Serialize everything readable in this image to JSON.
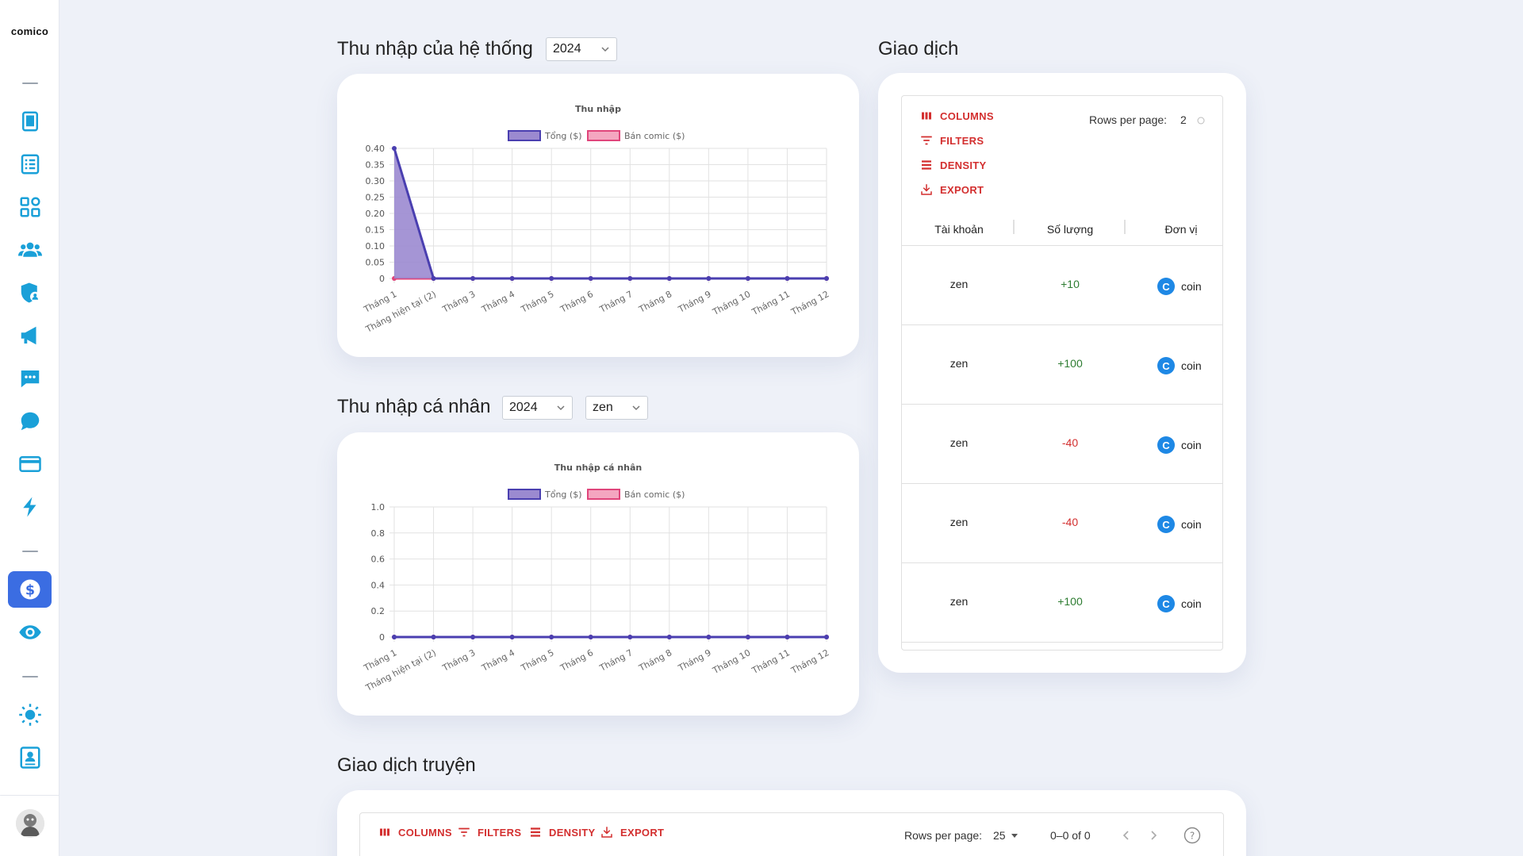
{
  "brand": "comico",
  "sidebar": {
    "items": [
      {
        "icon": "book-icon",
        "name": "sidebar-item-comics"
      },
      {
        "icon": "list-icon",
        "name": "sidebar-item-list"
      },
      {
        "icon": "grid-icon",
        "name": "sidebar-item-categories"
      },
      {
        "icon": "users-icon",
        "name": "sidebar-item-users"
      },
      {
        "icon": "shield-user-icon",
        "name": "sidebar-item-roles"
      },
      {
        "icon": "megaphone-icon",
        "name": "sidebar-item-announcements"
      },
      {
        "icon": "chat-dots-icon",
        "name": "sidebar-item-messages"
      },
      {
        "icon": "chat-bubble-icon",
        "name": "sidebar-item-comments"
      },
      {
        "icon": "credit-card-icon",
        "name": "sidebar-item-payments"
      },
      {
        "icon": "lightning-icon",
        "name": "sidebar-item-events"
      },
      {
        "icon": "dollar-icon",
        "name": "sidebar-item-income",
        "active": true
      },
      {
        "icon": "eye-icon",
        "name": "sidebar-item-views"
      },
      {
        "icon": "sun-icon",
        "name": "sidebar-item-theme"
      },
      {
        "icon": "contact-card-icon",
        "name": "sidebar-item-profile"
      }
    ],
    "accent": "#3b6de2",
    "icon_color": "#1aa0d8"
  },
  "system_income": {
    "title": "Thu nhập của hệ thống",
    "year": "2024"
  },
  "personal_income": {
    "title": "Thu nhập cá nhân",
    "year": "2024",
    "user": "zen"
  },
  "chart_data": [
    {
      "type": "area",
      "title": "Thu nhập",
      "categories": [
        "Tháng 1",
        "Tháng hiện tại (2)",
        "Tháng 3",
        "Tháng 4",
        "Tháng 5",
        "Tháng 6",
        "Tháng 7",
        "Tháng 8",
        "Tháng 9",
        "Tháng 10",
        "Tháng 11",
        "Tháng 12"
      ],
      "series": [
        {
          "name": "Tổng ($)",
          "values": [
            0.4,
            0,
            0,
            0,
            0,
            0,
            0,
            0,
            0,
            0,
            0,
            0
          ],
          "color": "#4a3fb0",
          "fill": "#9b8ad0"
        },
        {
          "name": "Bán comic ($)",
          "values": [
            0,
            0,
            0,
            0,
            0,
            0,
            0,
            0,
            0,
            0,
            0,
            0
          ],
          "color": "#e0457b",
          "fill": "#f4a6c0"
        }
      ],
      "yticks": [
        "0.40",
        "0.35",
        "0.30",
        "0.25",
        "0.20",
        "0.15",
        "0.10",
        "0.05",
        "0"
      ],
      "ylim": [
        0,
        0.4
      ],
      "grid": true,
      "legend": "top"
    },
    {
      "type": "area",
      "title": "Thu nhập cá nhân",
      "categories": [
        "Tháng 1",
        "Tháng hiện tại (2)",
        "Tháng 3",
        "Tháng 4",
        "Tháng 5",
        "Tháng 6",
        "Tháng 7",
        "Tháng 8",
        "Tháng 9",
        "Tháng 10",
        "Tháng 11",
        "Tháng 12"
      ],
      "series": [
        {
          "name": "Tổng ($)",
          "values": [
            0,
            0,
            0,
            0,
            0,
            0,
            0,
            0,
            0,
            0,
            0,
            0
          ],
          "color": "#4a3fb0",
          "fill": "#9b8ad0"
        },
        {
          "name": "Bán comic ($)",
          "values": [
            0,
            0,
            0,
            0,
            0,
            0,
            0,
            0,
            0,
            0,
            0,
            0
          ],
          "color": "#e0457b",
          "fill": "#f4a6c0"
        }
      ],
      "yticks": [
        "1.0",
        "0.8",
        "0.6",
        "0.4",
        "0.2",
        "0"
      ],
      "ylim": [
        0,
        1
      ],
      "grid": true,
      "legend": "top"
    }
  ],
  "transactions": {
    "title": "Giao dịch",
    "toolbar": {
      "columns": "COLUMNS",
      "filters": "FILTERS",
      "density": "DENSITY",
      "export": "EXPORT"
    },
    "rows_per_page_label": "Rows per page:",
    "rows_per_page_value": "2",
    "headers": [
      "Tài khoản",
      "Số lượng",
      "Đơn vị"
    ],
    "rows": [
      {
        "account": "zen",
        "amount": "+10",
        "unit": "coin",
        "sign": "pos"
      },
      {
        "account": "zen",
        "amount": "+100",
        "unit": "coin",
        "sign": "pos"
      },
      {
        "account": "zen",
        "amount": "-40",
        "unit": "coin",
        "sign": "neg"
      },
      {
        "account": "zen",
        "amount": "-40",
        "unit": "coin",
        "sign": "neg"
      },
      {
        "account": "zen",
        "amount": "+100",
        "unit": "coin",
        "sign": "pos"
      }
    ],
    "positive_color": "#2e7d32",
    "negative_color": "#d32f2f"
  },
  "story_transactions": {
    "title": "Giao dịch truyện",
    "toolbar": {
      "columns": "COLUMNS",
      "filters": "FILTERS",
      "density": "DENSITY",
      "export": "EXPORT"
    },
    "rows_per_page_label": "Rows per page:",
    "rows_per_page_value": "25",
    "range": "0–0 of 0"
  }
}
